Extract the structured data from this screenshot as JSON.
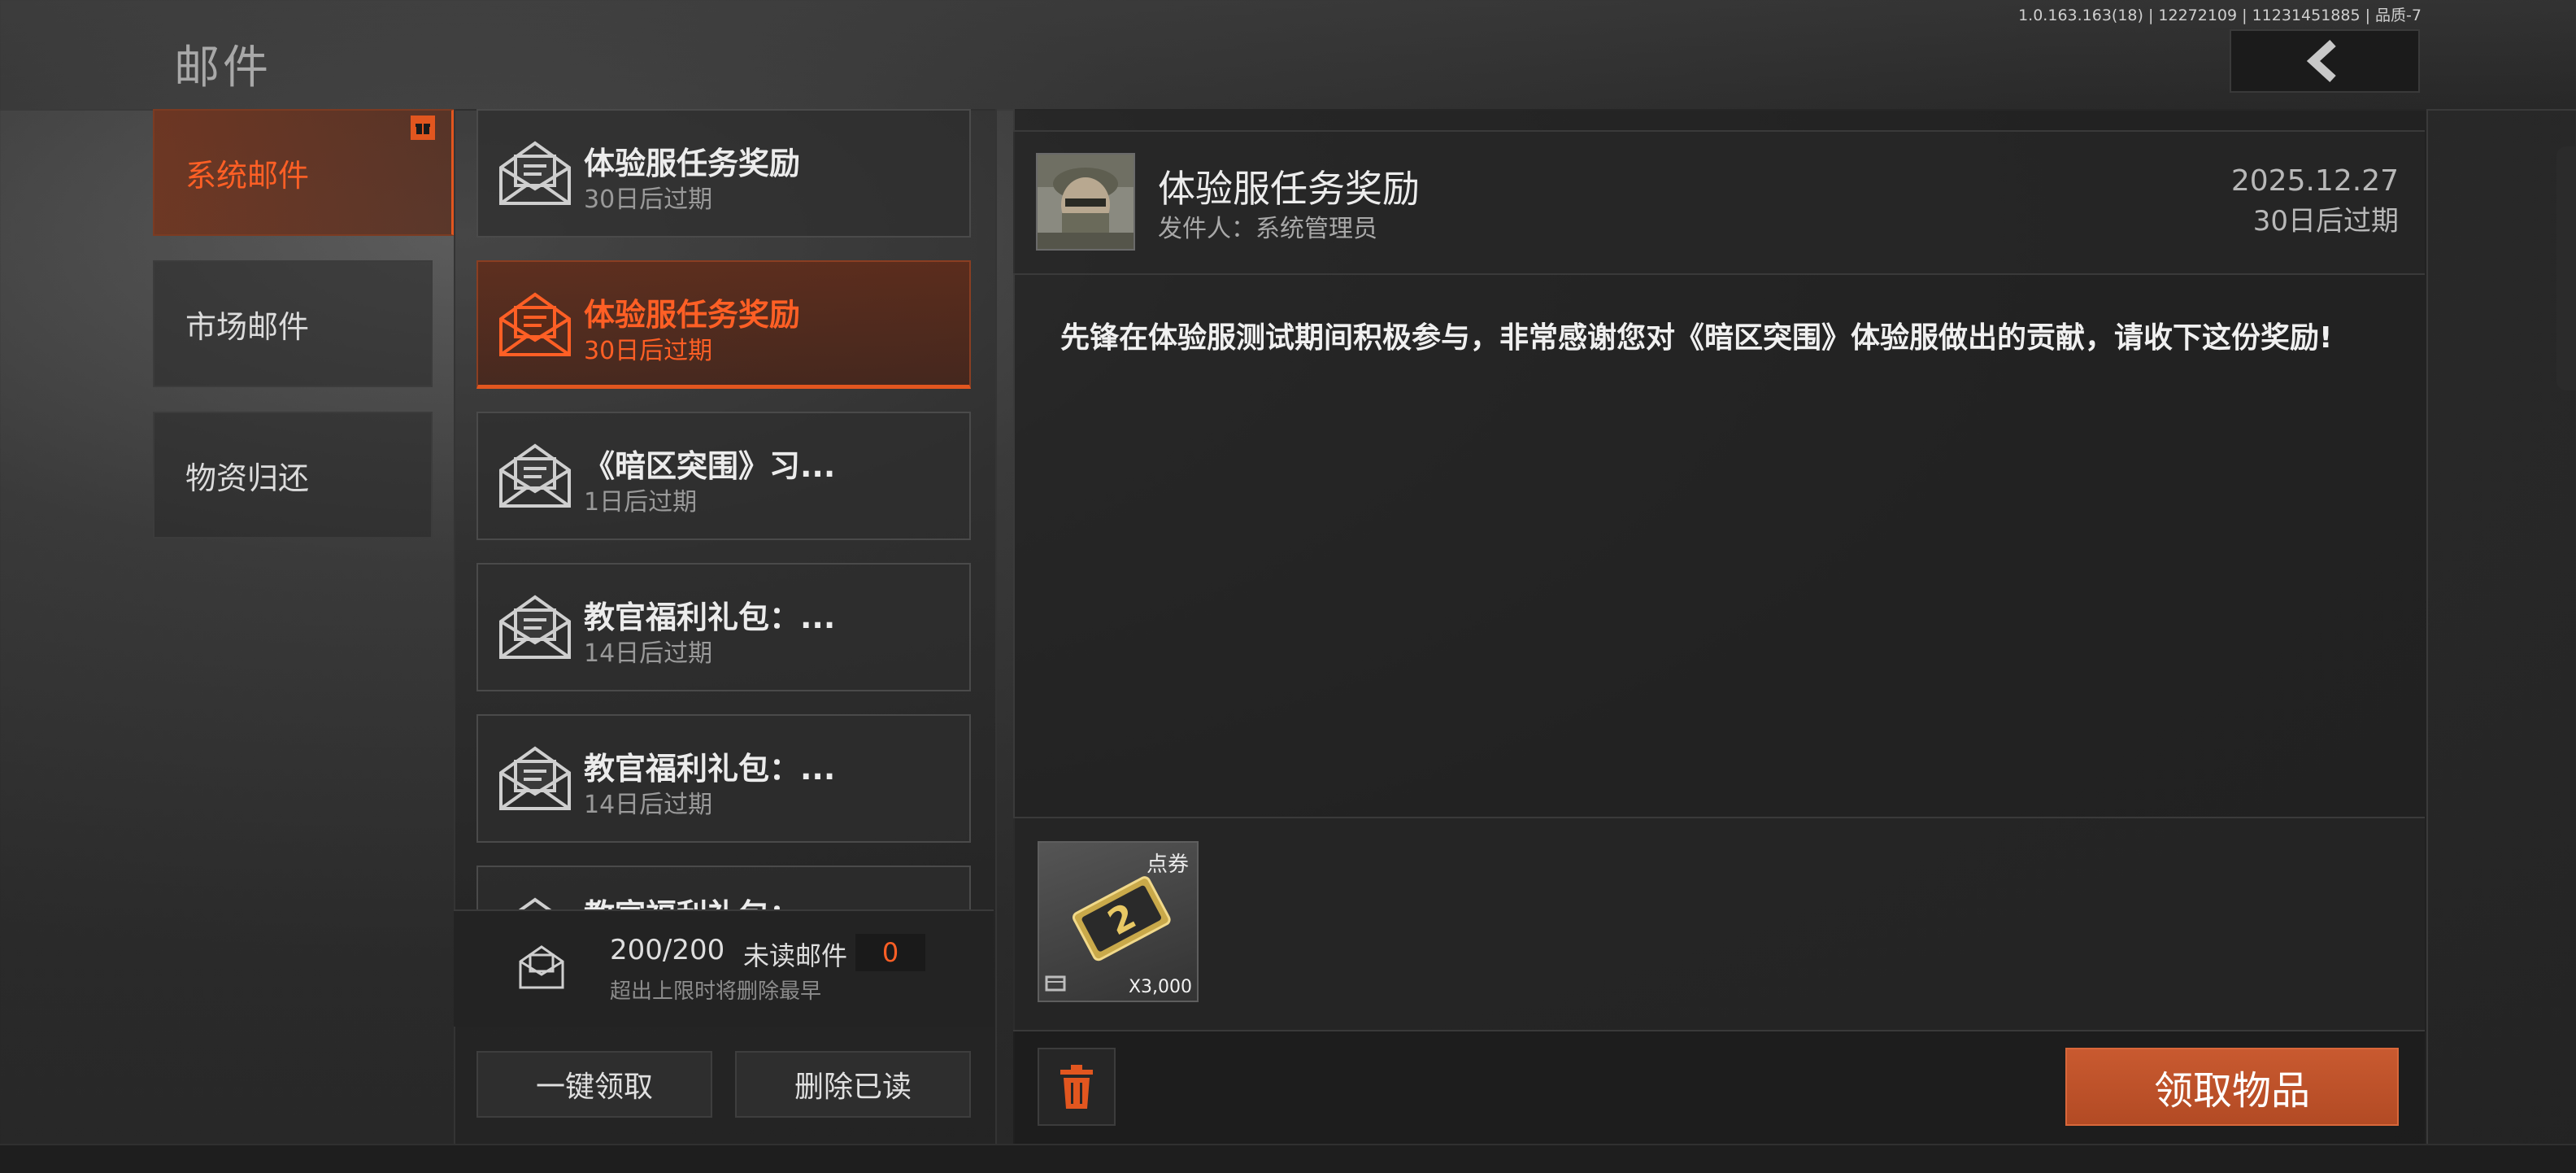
{
  "header": {
    "title": "邮件",
    "version": "1.0.163.163(18) | 12272109 | 11231451885 | 品质-7"
  },
  "categories": [
    {
      "label": "系统邮件",
      "active": true
    },
    {
      "label": "市场邮件",
      "active": false
    },
    {
      "label": "物资归还",
      "active": false
    }
  ],
  "mails": [
    {
      "title": "体验服任务奖励",
      "expiry": "30日后过期"
    },
    {
      "title": "体验服任务奖励",
      "expiry": "30日后过期",
      "active": true
    },
    {
      "title": "《暗区突围》习...",
      "expiry": "1日后过期"
    },
    {
      "title": "教官福利礼包：...",
      "expiry": "14日后过期"
    },
    {
      "title": "教官福利礼包：...",
      "expiry": "14日后过期"
    },
    {
      "title": "教官福利礼包：",
      "expiry": ""
    }
  ],
  "mailbox": {
    "count": "200/200",
    "unread_label": "未读邮件",
    "unread_count": "0",
    "limit_note": "超出上限时将删除最早"
  },
  "actions": {
    "claim_all": "一键领取",
    "delete_read": "删除已读",
    "claim_items": "领取物品"
  },
  "detail": {
    "title": "体验服任务奖励",
    "sender": "发件人：系统管理员",
    "date": "2025.12.27",
    "expiry": "30日后过期",
    "body": "先锋在体验服测试期间积极参与，非常感谢您对《暗区突围》体验服做出的贡献，请收下这份奖励!"
  },
  "attachment": {
    "type": "点券",
    "quantity": "X3,000"
  },
  "colors": {
    "accent": "#e2561f",
    "claim_button": "#c0542c",
    "unread": "#ff5f25"
  },
  "icons": [
    "envelope-icon",
    "back-arrow-icon",
    "trash-icon",
    "gift-icon",
    "voucher-icon"
  ]
}
